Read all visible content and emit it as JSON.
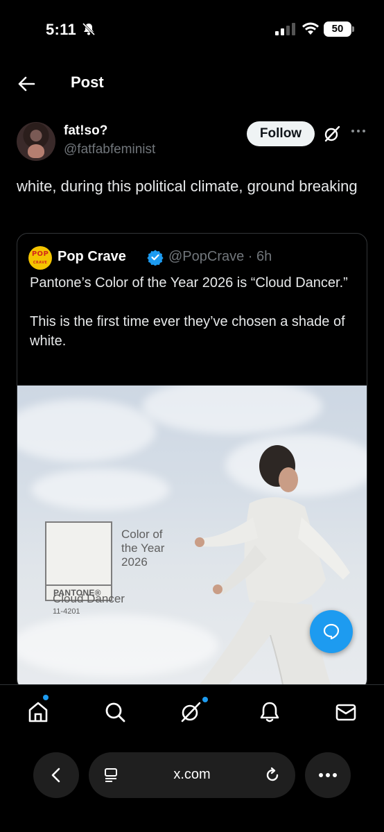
{
  "status_bar": {
    "time": "5:11",
    "battery": "50"
  },
  "header": {
    "title": "Post"
  },
  "post": {
    "author_name": "fat!so?",
    "author_handle": "@fatfabfeminist",
    "follow_label": "Follow",
    "text": "white, during this political climate, ground breaking"
  },
  "quoted_post": {
    "avatar_text": "POP",
    "avatar_subtext": "CRAVE",
    "name": "Pop Crave",
    "handle_time": "@PopCrave · 6h",
    "text": "Pantone’s Color of the Year 2026 is “Cloud Dancer.”\n\nThis is the first time ever they’ve chosen a shade of white.",
    "media": {
      "swatch_brand": "PANTONE®",
      "headline": "Color of\nthe Year\n2026",
      "color_name": "Cloud Dancer",
      "color_code": "11-4201"
    }
  },
  "bottom_nav": [
    "home-icon",
    "search-icon",
    "grok-icon",
    "notifications-icon",
    "messages-icon"
  ],
  "browser": {
    "url": "x.com"
  },
  "colors": {
    "accent": "#1d9bf0",
    "background": "#000000",
    "follow_bg": "#eff3f4"
  }
}
